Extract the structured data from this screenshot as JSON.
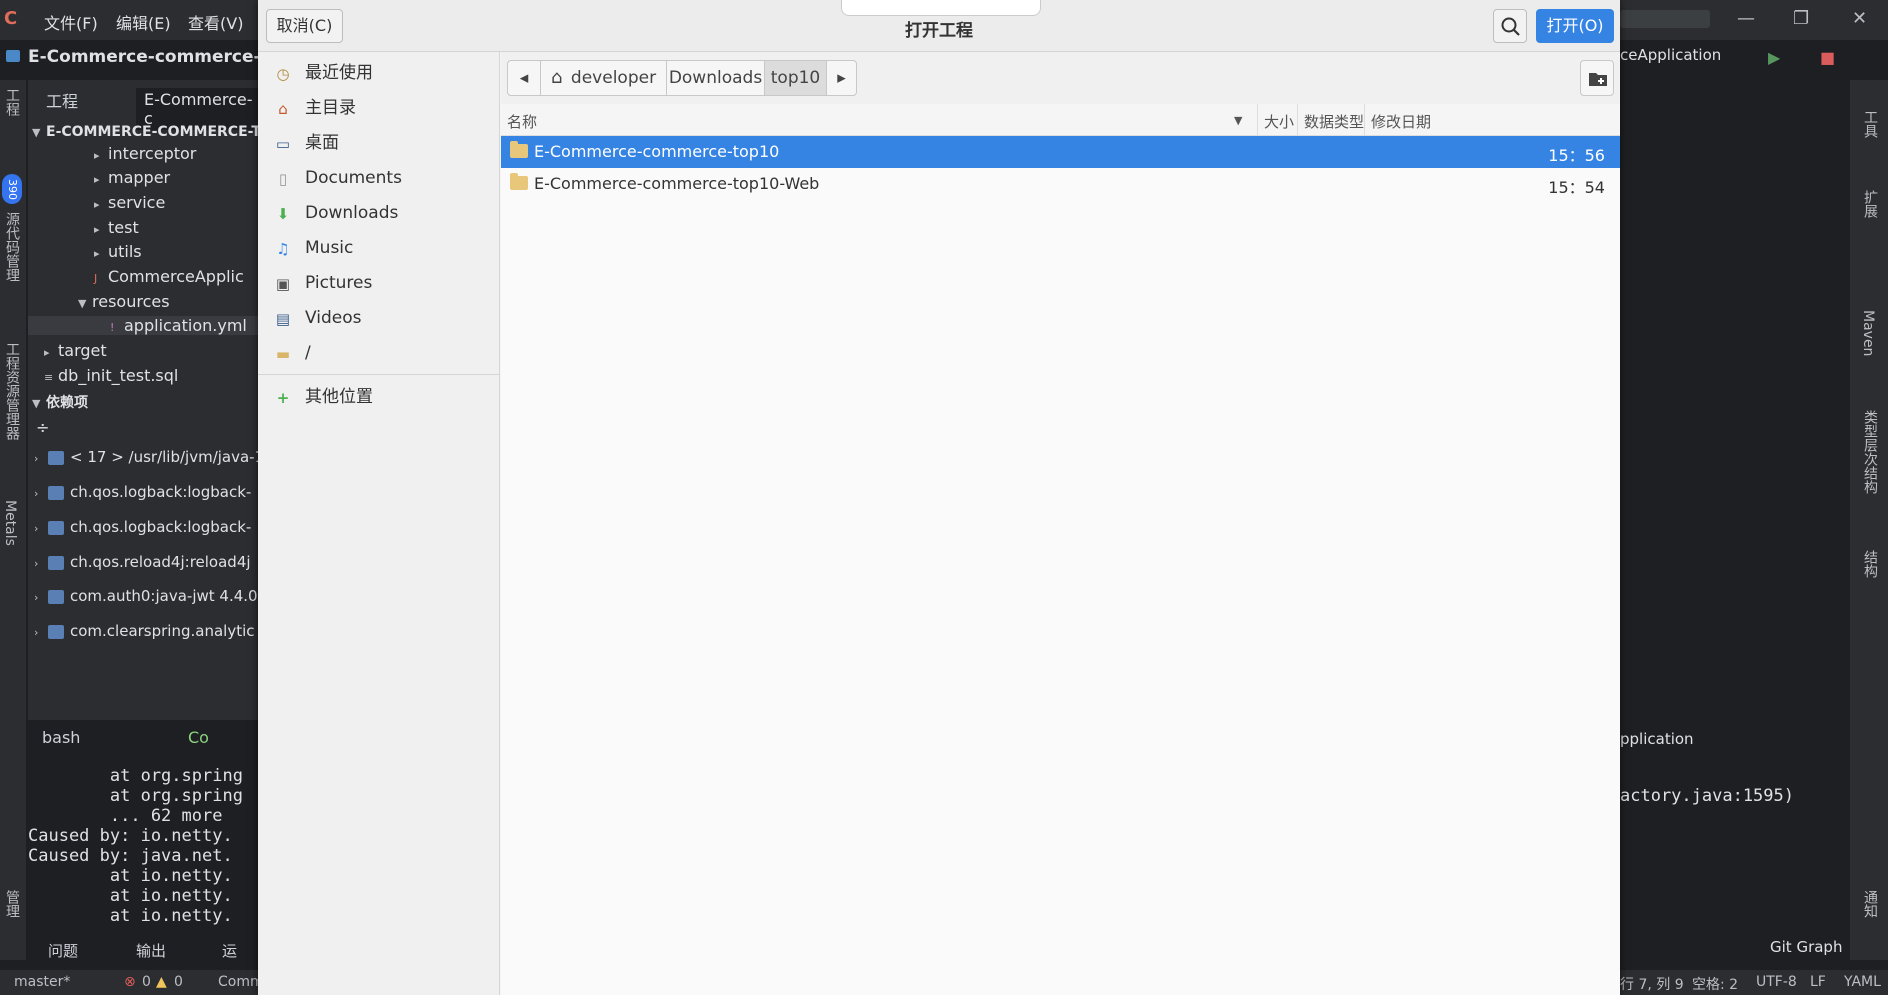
{
  "ide": {
    "menus": [
      "文件(F)",
      "编辑(E)",
      "查看(V)"
    ],
    "project_title": "E-Commerce-commerce-top1",
    "tool_tab": "工程",
    "project_tab": "E-Commerce-c",
    "tree_root": "E-COMMERCE-COMMERCE-TOP",
    "tree": [
      {
        "label": "interceptor",
        "indent": 1
      },
      {
        "label": "mapper",
        "indent": 1
      },
      {
        "label": "service",
        "indent": 1
      },
      {
        "label": "test",
        "indent": 1
      },
      {
        "label": "utils",
        "indent": 1
      },
      {
        "label": "CommerceApplic",
        "indent": 1
      },
      {
        "label": "resources",
        "indent": 0
      },
      {
        "label": "application.yml",
        "indent": 1
      },
      {
        "label": "target",
        "indent": 0
      },
      {
        "label": "db_init_test.sql",
        "indent": 0
      }
    ],
    "deps_title": "依赖项",
    "deps": [
      "< 17 > /usr/lib/jvm/java-1",
      "ch.qos.logback:logback-",
      "ch.qos.logback:logback-",
      "ch.qos.reload4j:reload4j",
      "com.auth0:java-jwt 4.4.0",
      "com.clearspring.analytic"
    ],
    "terminal_tabs": [
      "bash",
      "Co"
    ],
    "terminal_lines": [
      "        at org.spring",
      "        at org.spring",
      "        ... 62 more",
      "Caused by: io.netty.",
      "Caused by: java.net.",
      "        at io.netty.",
      "        at io.netty.",
      "        at io.netty."
    ],
    "bottom_tabs": [
      "问题",
      "输出",
      "运"
    ],
    "run_config": "ceApplication",
    "run_panel_title": "pplication",
    "right_terminal_line": "actory.java:1595)",
    "right_strip_labels": [
      "工具",
      "扩展",
      "Maven",
      "类型层次结构",
      "结构",
      "通知"
    ],
    "left_strip_labels": [
      "工程",
      "源代码管理",
      "工程资源管理器",
      "Metals",
      "管理"
    ],
    "left_badge": "390",
    "git_graph": "Git Graph",
    "status": {
      "branch": "master*",
      "errors": "0",
      "warnings": "0",
      "comm": "Comm",
      "position": "行 7, 列 9",
      "spaces": "空格: 2",
      "encoding": "UTF-8",
      "eol": "LF",
      "lang": "YAML"
    }
  },
  "dialog": {
    "title": "打开工程",
    "cancel_label": "取消(C)",
    "open_label": "打开(O)",
    "places": [
      {
        "label": "最近使用",
        "icon": "recent-icon"
      },
      {
        "label": "主目录",
        "icon": "home-icon"
      },
      {
        "label": "桌面",
        "icon": "desktop-icon"
      },
      {
        "label": "Documents",
        "icon": "document-icon"
      },
      {
        "label": "Downloads",
        "icon": "download-icon"
      },
      {
        "label": "Music",
        "icon": "music-icon"
      },
      {
        "label": "Pictures",
        "icon": "picture-icon"
      },
      {
        "label": "Videos",
        "icon": "video-icon"
      },
      {
        "label": "/",
        "icon": "folder-icon"
      }
    ],
    "other_locations": "其他位置",
    "path": [
      "developer",
      "Downloads",
      "top10"
    ],
    "columns": {
      "name": "名称",
      "size": "大小",
      "type": "数据类型",
      "modified": "修改日期"
    },
    "files": [
      {
        "name": "E-Commerce-commerce-top10",
        "modified": "15：56",
        "selected": true
      },
      {
        "name": "E-Commerce-commerce-top10-Web",
        "modified": "15：54",
        "selected": false
      }
    ],
    "accent": "#3584e4"
  }
}
